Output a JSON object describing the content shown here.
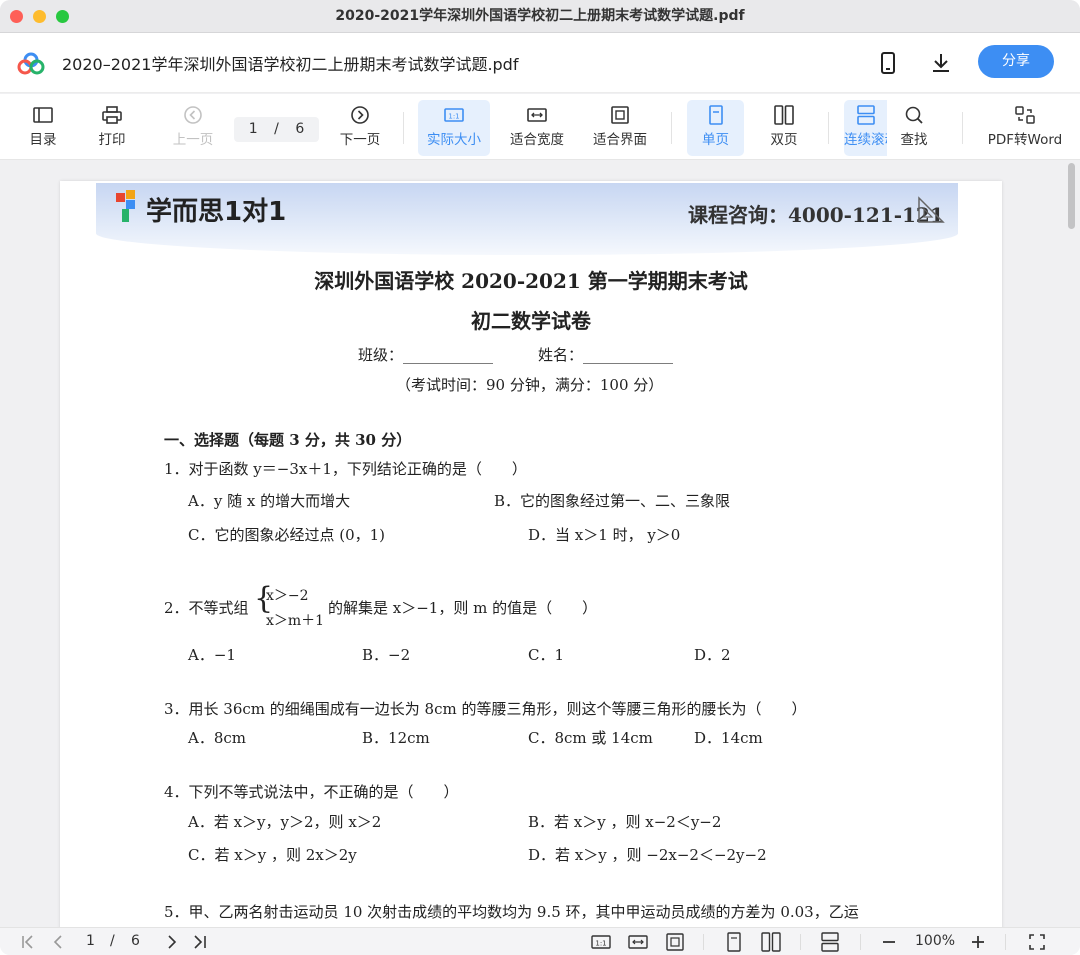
{
  "window": {
    "title": "2020-2021学年深圳外国语学校初二上册期末考试数学试题.pdf"
  },
  "header": {
    "file_title": "2020–2021学年深圳外国语学校初二上册期末考试数学试题.pdf",
    "share_label": "分享"
  },
  "toolbar": {
    "catalog": "目录",
    "print": "打印",
    "prev": "上一页",
    "page_current": "1",
    "page_sep": "/",
    "page_total": "6",
    "next": "下一页",
    "actual_size": "实际大小",
    "fit_width": "适合宽度",
    "fit_screen": "适合界面",
    "single": "单页",
    "double": "双页",
    "continuous": "连续滚动",
    "search": "查找",
    "to_word": "PDF转Word"
  },
  "pdf": {
    "brand": "学而思1对1",
    "consult": "课程咨询：4000-121-121",
    "title": "深圳外国语学校 2020-2021 第一学期期末考试",
    "subtitle": "初二数学试卷",
    "info_line": "班级：____________　　　姓名：____________",
    "time_line": "（考试时间：90 分钟，满分：100 分）",
    "section1": "一、选择题（每题 3 分，共 30 分）",
    "q1": "1．对于函数 y＝−3x＋1，下列结论正确的是（　　）",
    "q1a": "A．y 随 x 的增大而增大",
    "q1b": "B．它的图象经过第一、二、三象限",
    "q1c": "C．它的图象必经过点 (0，1)",
    "q1d": "D．当 x＞1 时， y＞0",
    "q2_pre": "2．不等式组",
    "q2_l1": "x＞−2",
    "q2_l2": "x＞m＋1",
    "q2_post": "的解集是 x＞−1，则 m 的值是（　　）",
    "q2a": "A．−1",
    "q2b": "B．−2",
    "q2c": "C．1",
    "q2d": "D．2",
    "q3": "3．用长 36cm 的细绳围成有一边长为 8cm 的等腰三角形，则这个等腰三角形的腰长为（　　）",
    "q3a": "A．8cm",
    "q3b": "B．12cm",
    "q3c": "C．8cm 或 14cm",
    "q3d": "D．14cm",
    "q4": "4．下列不等式说法中，不正确的是（　　）",
    "q4a": "A．若 x＞y，y＞2，则 x＞2",
    "q4b": "B．若 x＞y ，则 x−2＜y−2",
    "q4c": "C．若 x＞y ，则 2x＞2y",
    "q4d": "D．若 x＞y ，则 −2x−2＜−2y−2",
    "q5": "5．甲、乙两名射击运动员 10 次射击成绩的平均数均为 9.5 环，其中甲运动员成绩的方差为 0.03，乙运"
  },
  "bottombar": {
    "page_current": "1",
    "page_sep": "/",
    "page_total": "6",
    "zoom": "100%"
  }
}
